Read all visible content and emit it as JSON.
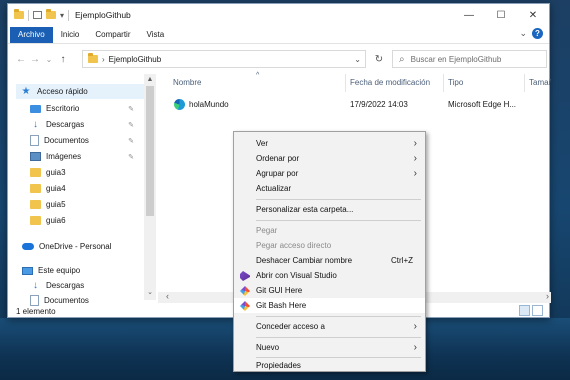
{
  "window": {
    "title": "EjemploGithub",
    "controls": {
      "minimize": "—",
      "maximize": "☐",
      "close": "✕"
    }
  },
  "ribbon": {
    "tabs": [
      "Archivo",
      "Inicio",
      "Compartir",
      "Vista"
    ],
    "expand": "⌄",
    "help": "?"
  },
  "address": {
    "back": "←",
    "forward": "→",
    "recent": "⌄",
    "up": "↑",
    "chevron": "›",
    "path": "EjemploGithub",
    "dropdown": "⌄",
    "refresh": "↻",
    "search_icon": "⌕",
    "search_placeholder": "Buscar en EjemploGithub"
  },
  "nav": {
    "items": [
      {
        "label": "Acceso rápido",
        "icon": "star-icon",
        "pinned": false
      },
      {
        "label": "Escritorio",
        "icon": "desktop-icon",
        "pinned": true
      },
      {
        "label": "Descargas",
        "icon": "download-icon",
        "pinned": true
      },
      {
        "label": "Documentos",
        "icon": "document-icon",
        "pinned": true
      },
      {
        "label": "Imágenes",
        "icon": "image-icon",
        "pinned": true
      },
      {
        "label": "guia3",
        "icon": "folder-icon",
        "pinned": false
      },
      {
        "label": "guia4",
        "icon": "folder-icon",
        "pinned": false
      },
      {
        "label": "guia5",
        "icon": "folder-icon",
        "pinned": false
      },
      {
        "label": "guia6",
        "icon": "folder-icon",
        "pinned": false
      },
      {
        "label": "OneDrive - Personal",
        "icon": "onedrive-icon",
        "pinned": false
      },
      {
        "label": "Este equipo",
        "icon": "pc-icon",
        "pinned": false
      },
      {
        "label": "Descargas",
        "icon": "download-icon",
        "pinned": false
      },
      {
        "label": "Documentos",
        "icon": "document-icon",
        "pinned": false
      }
    ],
    "pin_glyph": "✎",
    "scroll_up": "▲",
    "scroll_down": "⌄"
  },
  "content": {
    "columns": [
      "Nombre",
      "Fecha de modificación",
      "Tipo",
      "Tamaño"
    ],
    "sort_glyph": "^",
    "rows": [
      {
        "name": "holaMundo",
        "modified": "17/9/2022 14:03",
        "type": "Microsoft Edge H...",
        "icon": "edge-icon"
      }
    ],
    "scroll_left": "‹",
    "scroll_right": "›"
  },
  "status": {
    "text": "1 elemento"
  },
  "context_menu": {
    "items": [
      {
        "label": "Ver",
        "submenu": true
      },
      {
        "label": "Ordenar por",
        "submenu": true
      },
      {
        "label": "Agrupar por",
        "submenu": true
      },
      {
        "label": "Actualizar"
      },
      {
        "label": "Personalizar esta carpeta..."
      },
      {
        "label": "Pegar",
        "disabled": true
      },
      {
        "label": "Pegar acceso directo",
        "disabled": true
      },
      {
        "label": "Deshacer Cambiar nombre",
        "shortcut": "Ctrl+Z"
      },
      {
        "label": "Abrir con Visual Studio",
        "icon": "visual-studio-icon"
      },
      {
        "label": "Git GUI Here",
        "icon": "git-gui-icon"
      },
      {
        "label": "Git Bash Here",
        "icon": "git-bash-icon",
        "highlighted": true
      },
      {
        "label": "Conceder acceso a",
        "submenu": true
      },
      {
        "label": "Nuevo",
        "submenu": true
      },
      {
        "label": "Propiedades"
      }
    ],
    "submenu_glyph": "›"
  }
}
